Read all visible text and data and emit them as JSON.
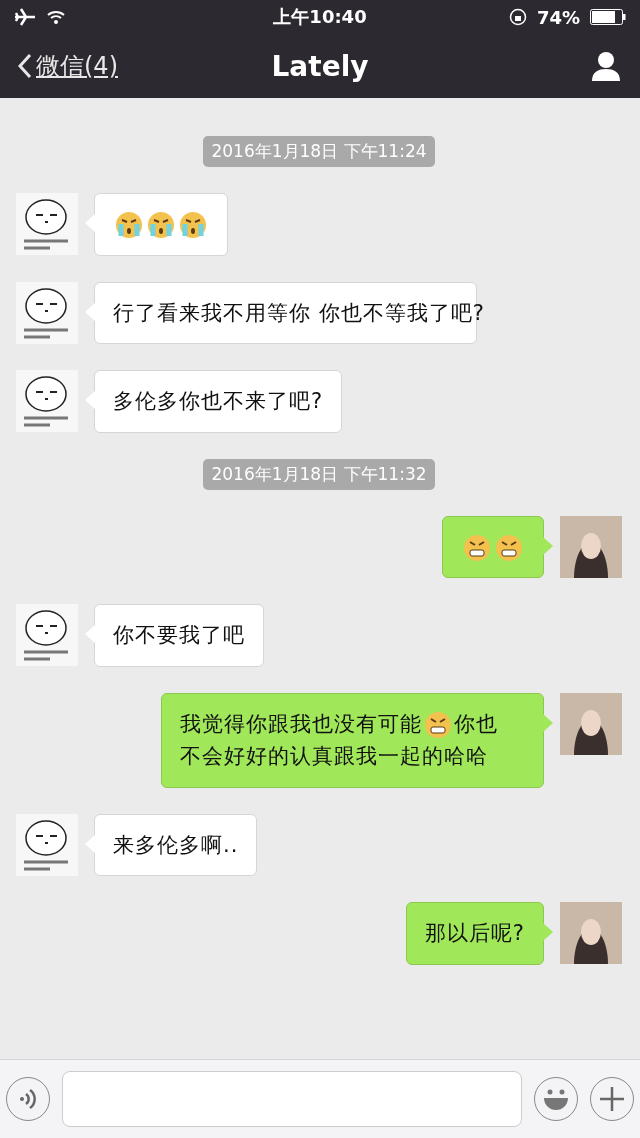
{
  "status_bar": {
    "time": "上午10:40",
    "battery": "74%",
    "airplane": true,
    "wifi": true,
    "rotation_lock": true
  },
  "nav": {
    "back": "微信(4)",
    "title": "Lately"
  },
  "messages": [
    {
      "kind": "time",
      "text": "2016年1月18日 下午11:24"
    },
    {
      "kind": "in",
      "parts": [
        {
          "kind": "cry"
        },
        {
          "kind": "cry"
        },
        {
          "kind": "cry"
        }
      ]
    },
    {
      "kind": "in",
      "parts": [
        {
          "kind": "text",
          "text": "行了看来我不用等你 你也不等我了吧?"
        }
      ]
    },
    {
      "kind": "in",
      "parts": [
        {
          "kind": "text",
          "text": "多伦多你也不来了吧?"
        }
      ]
    },
    {
      "kind": "time",
      "text": "2016年1月18日 下午11:32"
    },
    {
      "kind": "out",
      "parts": [
        {
          "kind": "angry"
        },
        {
          "kind": "angry"
        }
      ]
    },
    {
      "kind": "in",
      "parts": [
        {
          "kind": "text",
          "text": "你不要我了吧"
        }
      ]
    },
    {
      "kind": "out",
      "parts": [
        {
          "kind": "text",
          "text": "我觉得你跟我也没有可能"
        },
        {
          "kind": "angry"
        },
        {
          "kind": "text",
          "text": "你也"
        },
        {
          "kind": "text",
          "text": "不会好好的认真跟我一起的哈哈"
        }
      ]
    },
    {
      "kind": "in",
      "parts": [
        {
          "kind": "text",
          "text": "来多伦多啊.."
        }
      ]
    },
    {
      "kind": "out",
      "parts": [
        {
          "kind": "text",
          "text": "那以后呢?"
        }
      ]
    }
  ]
}
